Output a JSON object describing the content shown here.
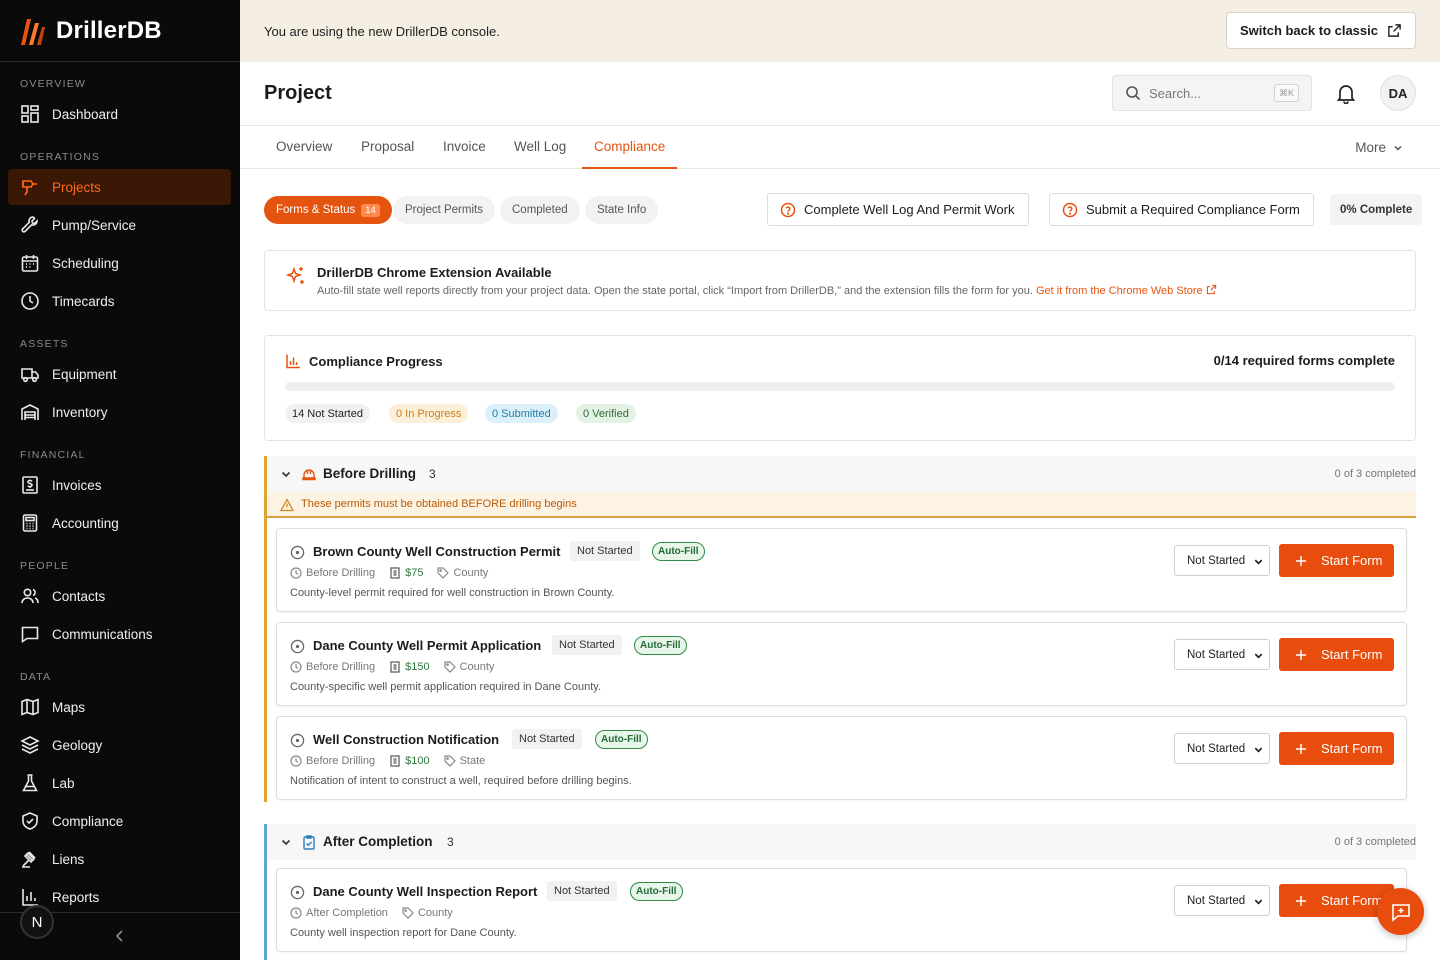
{
  "app": {
    "name": "DrillerDB"
  },
  "sidebar": {
    "sections": [
      "OVERVIEW",
      "OPERATIONS",
      "ASSETS",
      "FINANCIAL",
      "PEOPLE",
      "DATA"
    ],
    "items": [
      {
        "label": "Dashboard",
        "icon": "dashboard-icon"
      },
      {
        "label": "Projects",
        "icon": "drill-icon",
        "active": true
      },
      {
        "label": "Pump/Service",
        "icon": "wrench-icon"
      },
      {
        "label": "Scheduling",
        "icon": "calendar-icon"
      },
      {
        "label": "Timecards",
        "icon": "clock-icon"
      },
      {
        "label": "Equipment",
        "icon": "truck-icon"
      },
      {
        "label": "Inventory",
        "icon": "warehouse-icon"
      },
      {
        "label": "Invoices",
        "icon": "invoice-icon"
      },
      {
        "label": "Accounting",
        "icon": "calculator-icon"
      },
      {
        "label": "Contacts",
        "icon": "users-icon"
      },
      {
        "label": "Communications",
        "icon": "message-icon"
      },
      {
        "label": "Maps",
        "icon": "map-icon"
      },
      {
        "label": "Geology",
        "icon": "layers-icon"
      },
      {
        "label": "Lab",
        "icon": "flask-icon"
      },
      {
        "label": "Compliance",
        "icon": "shield-check-icon"
      },
      {
        "label": "Liens",
        "icon": "gavel-icon"
      },
      {
        "label": "Reports",
        "icon": "bar-chart-icon"
      }
    ],
    "user_badge": "N"
  },
  "banner": {
    "message": "You are using the new DrillerDB console.",
    "button": "Switch back to classic"
  },
  "header": {
    "title": "Project",
    "search_placeholder": "Search...",
    "search_shortcut": "⌘K",
    "avatar": "DA"
  },
  "tabs": {
    "items": [
      "Overview",
      "Proposal",
      "Invoice",
      "Well Log",
      "Compliance"
    ],
    "active": "Compliance",
    "more": "More"
  },
  "filters": {
    "pills": [
      {
        "label": "Forms & Status",
        "count": "14",
        "active": true
      },
      {
        "label": "Project Permits"
      },
      {
        "label": "Completed"
      },
      {
        "label": "State Info"
      }
    ],
    "actions": [
      "Complete Well Log And Permit Work",
      "Submit a Required Compliance Form"
    ],
    "percent_complete": "0% Complete"
  },
  "extension": {
    "title": "DrillerDB Chrome Extension Available",
    "description": "Auto-fill state well reports directly from your project data. Open the state portal, click “Import from DrillerDB,” and the extension fills the form for you.",
    "link": "Get it from the Chrome Web Store"
  },
  "progress": {
    "title": "Compliance Progress",
    "summary": "0/14 required forms complete",
    "fraction_complete": 0,
    "chips": [
      {
        "label": "14 Not Started",
        "bg": "#f1f1f1",
        "fg": "#222222"
      },
      {
        "label": "0 In Progress",
        "bg": "#fcefd9",
        "fg": "#c9821a"
      },
      {
        "label": "0 Submitted",
        "bg": "#dcf0fa",
        "fg": "#1f7ea8"
      },
      {
        "label": "0 Verified",
        "bg": "#e3f2e4",
        "fg": "#2f6b38"
      }
    ]
  },
  "sections": [
    {
      "title": "Before Drilling",
      "count": "3",
      "completed": "0 of 3 completed",
      "accent": "#e0a531",
      "warning": "These permits must be obtained BEFORE drilling begins",
      "forms": [
        {
          "title": "Brown County Well Construction Permit",
          "status": "Not Started",
          "badge": "Auto-Fill",
          "phase": "Before Drilling",
          "fee": "$75",
          "jurisdiction": "County",
          "description": "County-level permit required for well construction in Brown County.",
          "select": "Not Started",
          "action": "Start Form"
        },
        {
          "title": "Dane County Well Permit Application",
          "status": "Not Started",
          "badge": "Auto-Fill",
          "phase": "Before Drilling",
          "fee": "$150",
          "jurisdiction": "County",
          "description": "County-specific well permit application required in Dane County.",
          "select": "Not Started",
          "action": "Start Form"
        },
        {
          "title": "Well Construction Notification",
          "status": "Not Started",
          "badge": "Auto-Fill",
          "phase": "Before Drilling",
          "fee": "$100",
          "jurisdiction": "State",
          "description": "Notification of intent to construct a well, required before drilling begins.",
          "select": "Not Started",
          "action": "Start Form"
        }
      ]
    },
    {
      "title": "After Completion",
      "count": "3",
      "completed": "0 of 3 completed",
      "accent": "#5aa7d6",
      "forms": [
        {
          "title": "Dane County Well Inspection Report",
          "status": "Not Started",
          "badge": "Auto-Fill",
          "phase": "After Completion",
          "jurisdiction": "County",
          "description": "County well inspection report for Dane County.",
          "select": "Not Started",
          "action": "Start Form"
        }
      ]
    }
  ],
  "colors": {
    "accent": "#e5540f",
    "sidebar_bg": "#0a0a0a",
    "banner_bg": "#f5eee2"
  }
}
